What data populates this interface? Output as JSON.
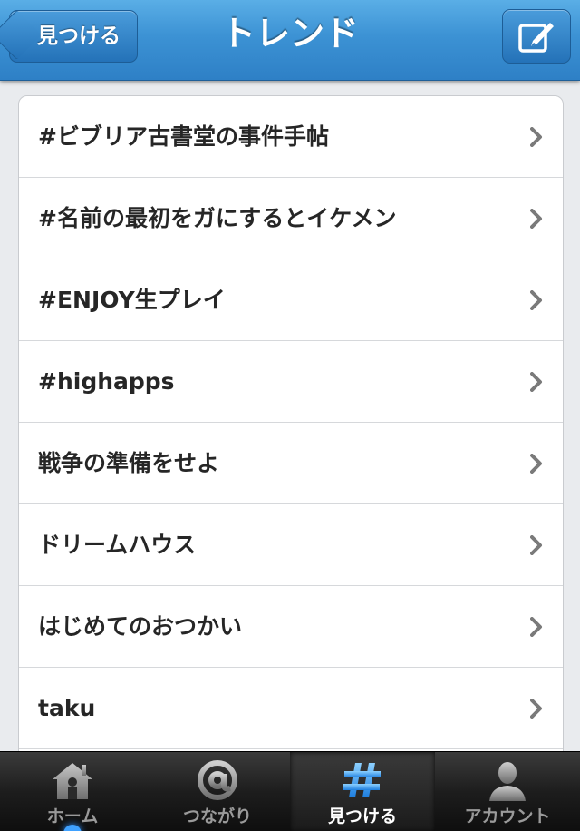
{
  "navbar": {
    "back_label": "見つける",
    "title": "トレンド",
    "compose_icon": "compose-icon"
  },
  "trends": [
    "#ビブリア古書堂の事件手帖",
    "#名前の最初をガにするとイケメン",
    "#ENJOY生プレイ",
    "#highapps",
    "戦争の準備をせよ",
    "ドリームハウス",
    "はじめてのおつかい",
    "taku"
  ],
  "tabbar": {
    "tabs": [
      {
        "label": "ホーム",
        "icon": "home-icon"
      },
      {
        "label": "つながり",
        "icon": "at-icon"
      },
      {
        "label": "見つける",
        "icon": "hashtag-icon"
      },
      {
        "label": "アカウント",
        "icon": "person-icon"
      }
    ],
    "active_index": 2
  },
  "colors": {
    "nav_blue": "#3c92d4",
    "tab_active_blue": "#3fa1ff",
    "text": "#262626",
    "chevron": "#7a7a7a"
  }
}
